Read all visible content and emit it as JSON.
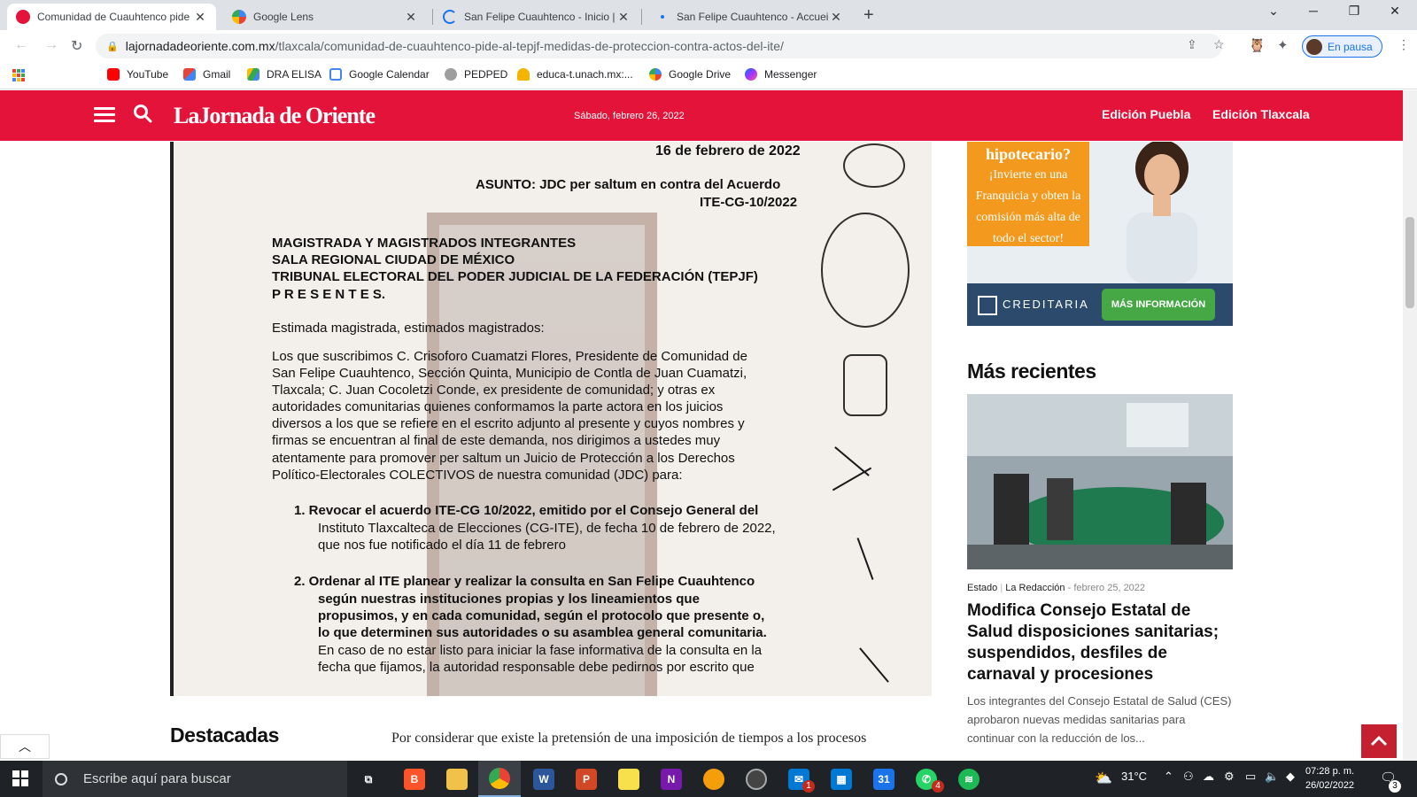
{
  "browser": {
    "tabs": [
      {
        "title": "Comunidad de Cuauhtenco pide",
        "active": true
      },
      {
        "title": "Google Lens",
        "active": false
      },
      {
        "title": "San Felipe Cuauhtenco - Inicio | F",
        "active": false
      },
      {
        "title": "San Felipe Cuauhtenco - Accueil",
        "active": false
      }
    ],
    "new_tab": "+",
    "url_host": "lajornadadeoriente.com.mx",
    "url_path": "/tlaxcala/comunidad-de-cuauhtenco-pide-al-tepjf-medidas-de-proteccion-contra-actos-del-ite/",
    "profile_label": "En pausa",
    "bookmarks": [
      "YouTube",
      "Gmail",
      "DRA ELISA",
      "Google Calendar",
      "PEDPED",
      "educa-t.unach.mx:...",
      "Google Drive",
      "Messenger"
    ]
  },
  "site": {
    "logo": "LaJornada de Oriente",
    "date": "Sábado, febrero 26, 2022",
    "edition_puebla": "Edición Puebla",
    "edition_tlaxcala": "Edición Tlaxcala",
    "brand_color": "#e4133a"
  },
  "document": {
    "lines": [
      "16 de febrero de 2022",
      "ASUNTO: JDC per saltum en contra del Acuerdo",
      "ITE-CG-10/2022",
      "MAGISTRADA Y MAGISTRADOS INTEGRANTES",
      "SALA REGIONAL CIUDAD DE MÉXICO",
      "TRIBUNAL ELECTORAL DEL PODER JUDICIAL DE LA FEDERACIÓN (TEPJF)",
      "P R E S E N T E S.",
      "Estimada magistrada, estimados magistrados:",
      "Los que suscribimos C. Crisoforo Cuamatzi Flores, Presidente de Comunidad de",
      "San Felipe Cuauhtenco, Sección Quinta, Municipio de Contla de Juan Cuamatzi,",
      "Tlaxcala; C. Juan Cocoletzi Conde, ex presidente de comunidad; y otras ex",
      "autoridades comunitarias quienes conformamos la parte actora en los juicios",
      "diversos a los que se refiere en el escrito adjunto al presente y cuyos nombres y",
      "firmas se encuentran al final de este demanda, nos dirigimos a ustedes muy",
      "atentamente para promover per saltum un Juicio de Protección a los Derechos",
      "Político-Electorales COLECTIVOS de nuestra comunidad (JDC) para:",
      "1.  Revocar el acuerdo ITE-CG 10/2022, emitido por el Consejo General del",
      "Instituto Tlaxcalteca de Elecciones (CG-ITE), de fecha 10 de febrero de 2022,",
      "que nos fue notificado el día 11 de febrero",
      "2.  Ordenar al ITE planear y realizar la consulta en San Felipe Cuauhtenco",
      "según nuestras instituciones propias y los lineamientos que",
      "propusimos, y en cada comunidad, según el protocolo que presente o,",
      "lo que determinen sus autoridades o su asamblea general comunitaria.",
      "En caso de no estar listo para iniciar la fase informativa de la consulta en la",
      "fecha que fijamos, la autoridad responsable debe pedirnos por escrito que"
    ]
  },
  "content": {
    "destacadas": "Destacadas",
    "paragraph": "Por considerar que existe la pretensión de una imposición de tiempos a los procesos"
  },
  "ad": {
    "question": "hipotecario?",
    "text_lines": [
      "¡Invierte en una",
      "Franquicia y obten la",
      "comisión más alta de",
      "todo el sector!"
    ],
    "brand": "CREDITARIA",
    "cta": "MÁS INFORMACIÓN"
  },
  "sidebar": {
    "title": "Más recientes",
    "article": {
      "category": "Estado",
      "author": "La Redacción",
      "date": "febrero 25, 2022",
      "title": "Modifica Consejo Estatal de Salud disposiciones sanitarias; suspendidos, desfiles de carnaval y procesiones",
      "excerpt": "Los integrantes del Consejo Estatal de Salud (CES) aprobaron nuevas medidas sanitarias para continuar con la reducción de los..."
    }
  },
  "taskbar": {
    "search_placeholder": "Escribe aquí para buscar",
    "temperature": "31°C",
    "time": "07:28 p. m.",
    "date": "26/02/2022",
    "mail_badge": "1",
    "whatsapp_badge": "4",
    "notif_badge": "3"
  }
}
